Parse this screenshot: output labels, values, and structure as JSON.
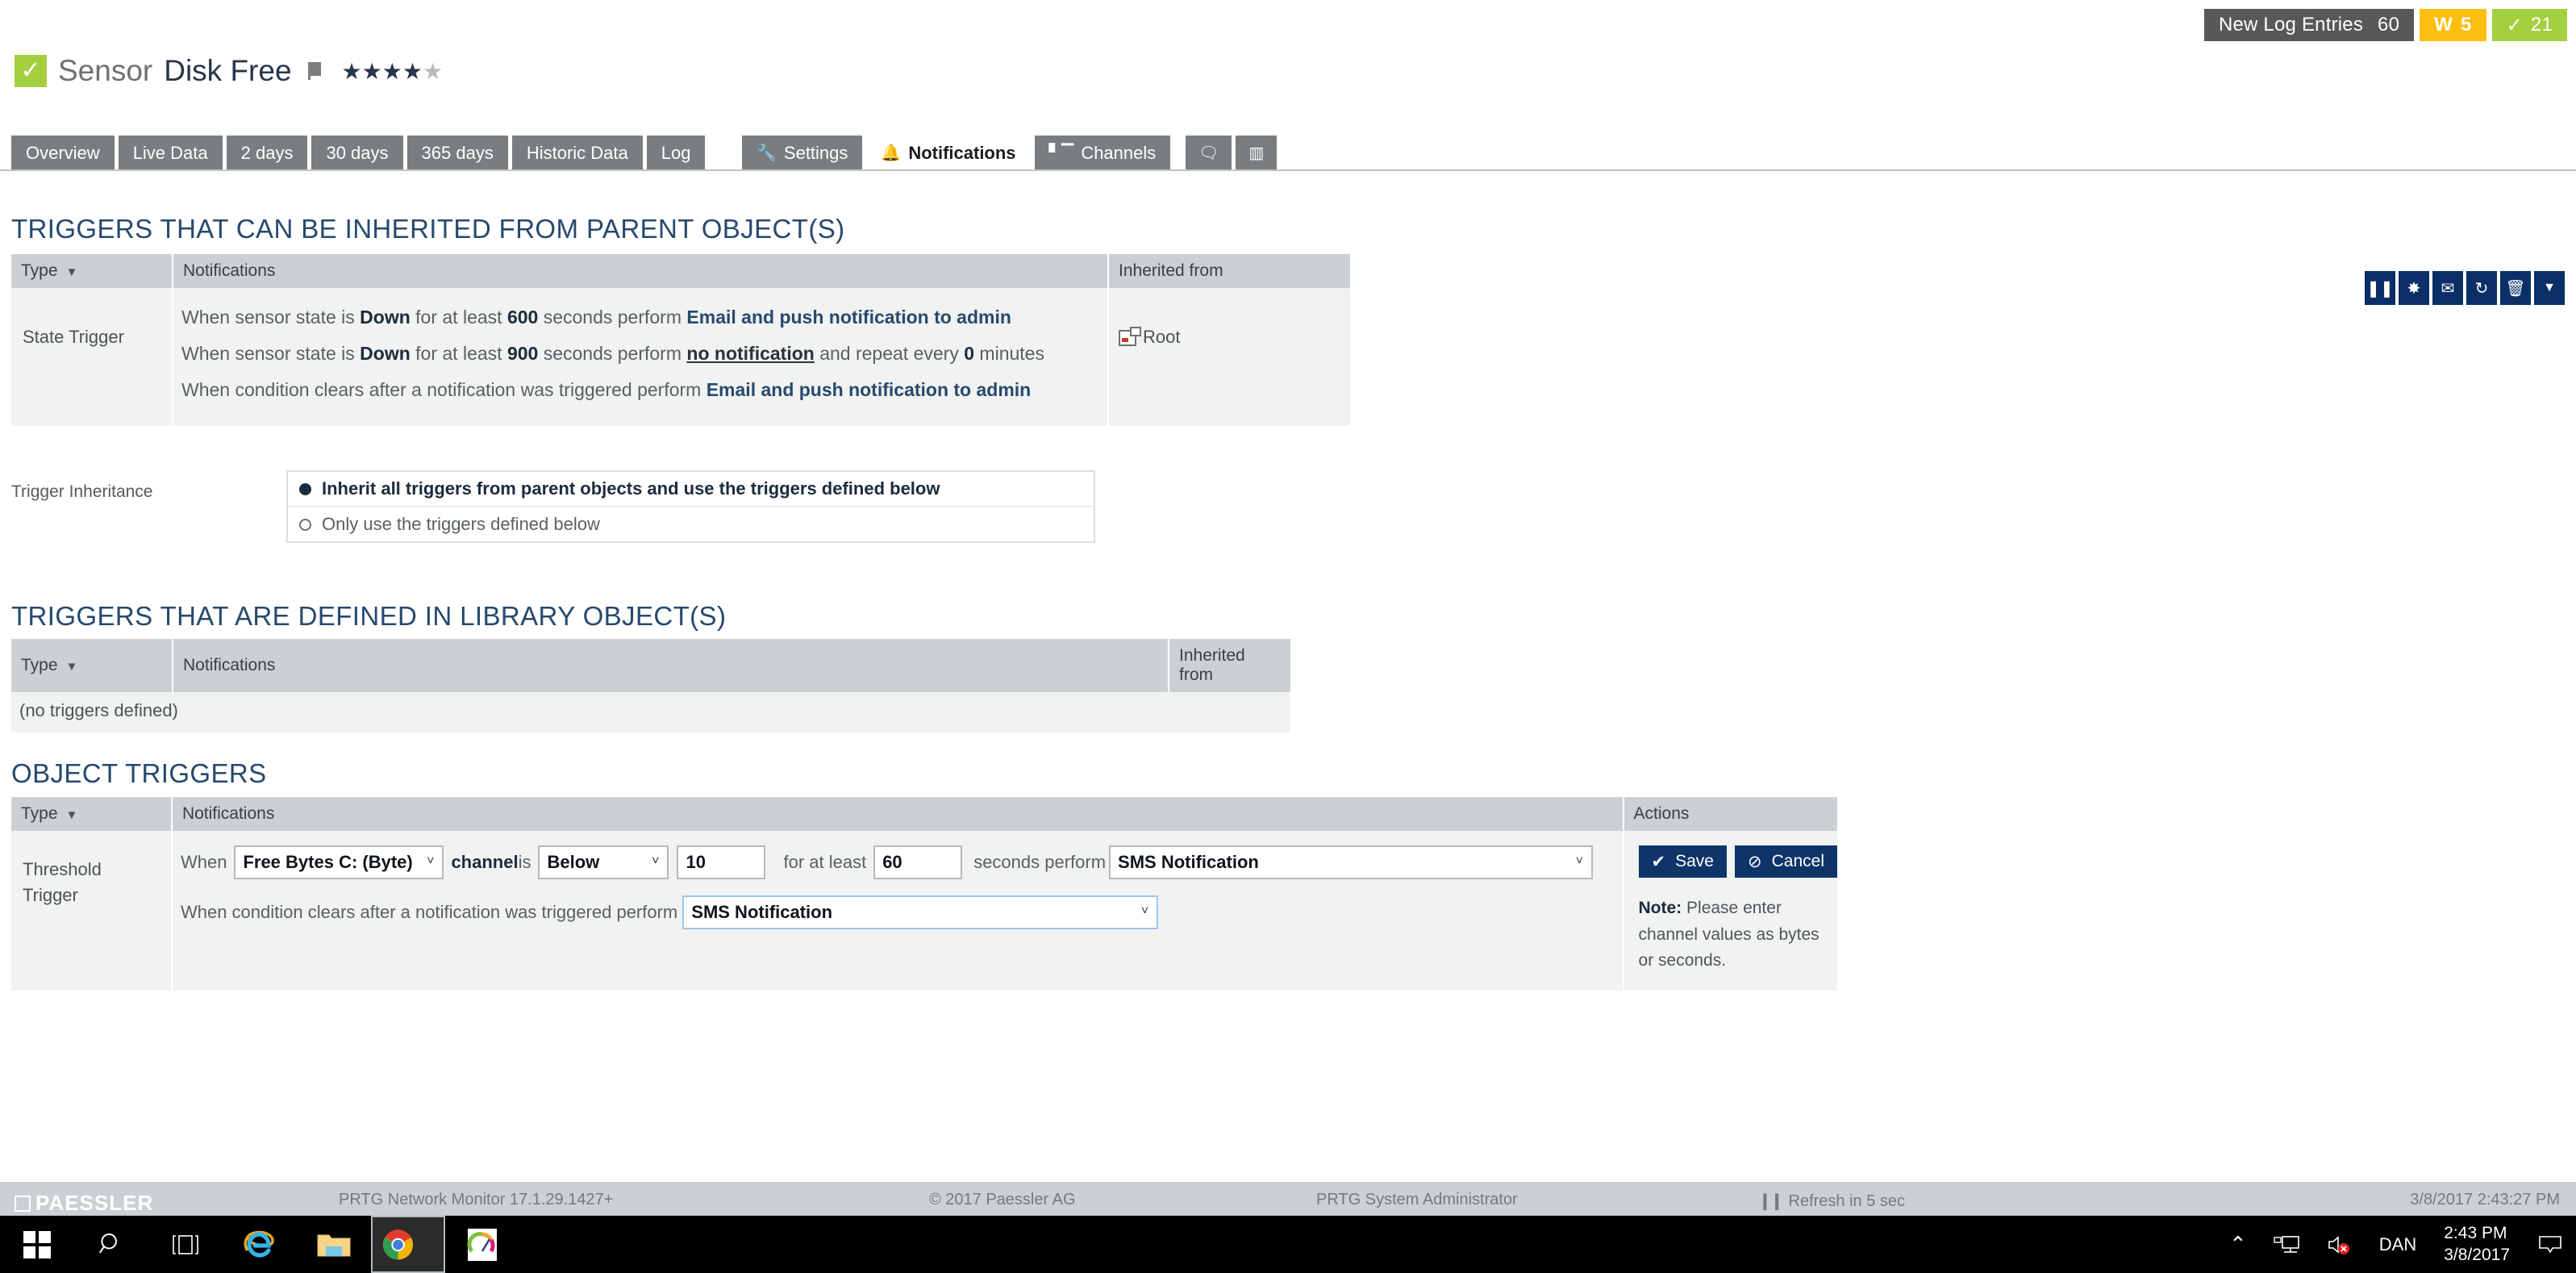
{
  "header": {
    "badges": [
      {
        "name": "new-log-entries",
        "label": "New Log Entries",
        "count": "60",
        "style": "dark"
      },
      {
        "name": "warning",
        "label": "W",
        "count": "5",
        "style": "warn"
      },
      {
        "name": "up",
        "label": "✓",
        "count": "21",
        "style": "ok"
      }
    ],
    "object_kind": "Sensor",
    "object_name": "Disk Free",
    "priority_stars_filled": 4,
    "priority_stars_total": 5,
    "state_icon": "check-icon"
  },
  "tabs": {
    "left": [
      {
        "id": "overview",
        "label": "Overview",
        "active": false
      },
      {
        "id": "live-data",
        "label": "Live Data",
        "active": false
      },
      {
        "id": "2-days",
        "label": "2 days",
        "active": false
      },
      {
        "id": "30-days",
        "label": "30 days",
        "active": false
      },
      {
        "id": "365-days",
        "label": "365 days",
        "active": false
      },
      {
        "id": "historic-data",
        "label": "Historic Data",
        "active": false
      },
      {
        "id": "log",
        "label": "Log",
        "active": false
      }
    ],
    "right": [
      {
        "id": "settings",
        "label": "Settings",
        "icon": "wrench-icon",
        "glyph": "🔧",
        "active": false
      },
      {
        "id": "notifications",
        "label": "Notifications",
        "icon": "bell-icon",
        "glyph": "🔔",
        "active": true
      },
      {
        "id": "channels",
        "label": "Channels",
        "icon": "bar-chart-icon",
        "glyph": "ᴍ",
        "active": false
      },
      {
        "id": "comments",
        "label": "",
        "icon": "comment-icon",
        "glyph": "💬",
        "active": false
      },
      {
        "id": "history",
        "label": "",
        "icon": "notebook-icon",
        "glyph": "▤",
        "active": false
      }
    ]
  },
  "toolbar": [
    {
      "id": "pause",
      "icon": "pause-icon",
      "glyph": "❙❙"
    },
    {
      "id": "new-ticket",
      "icon": "document-star-icon",
      "glyph": "✸"
    },
    {
      "id": "send-email",
      "icon": "envelope-icon",
      "glyph": "✉"
    },
    {
      "id": "scan-now",
      "icon": "refresh-icon",
      "glyph": "↺"
    },
    {
      "id": "delete",
      "icon": "trash-icon",
      "glyph": "🗑"
    },
    {
      "id": "more",
      "icon": "chevron-down-icon",
      "glyph": "▼"
    }
  ],
  "inherited_section": {
    "title": "TRIGGERS THAT CAN BE INHERITED FROM PARENT OBJECT(S)",
    "columns": [
      "Type",
      "Notifications",
      "Inherited from"
    ],
    "rows": [
      {
        "type": "State Trigger",
        "lines": [
          {
            "segments": [
              {
                "t": "When sensor state is ",
                "s": "plain"
              },
              {
                "t": "Down",
                "s": "bold"
              },
              {
                "t": " for at least ",
                "s": "plain"
              },
              {
                "t": "600",
                "s": "bold"
              },
              {
                "t": " seconds perform ",
                "s": "plain"
              },
              {
                "t": "Email and push notification to admin",
                "s": "link"
              }
            ]
          },
          {
            "segments": [
              {
                "t": "When sensor state is ",
                "s": "plain"
              },
              {
                "t": "Down",
                "s": "bold"
              },
              {
                "t": " for at least ",
                "s": "plain"
              },
              {
                "t": "900",
                "s": "bold"
              },
              {
                "t": " seconds perform ",
                "s": "plain"
              },
              {
                "t": "no notification",
                "s": "ulink"
              },
              {
                "t": " and repeat every ",
                "s": "plain"
              },
              {
                "t": "0",
                "s": "bold"
              },
              {
                "t": " minutes",
                "s": "plain"
              }
            ]
          },
          {
            "segments": [
              {
                "t": "When condition clears after a notification was triggered perform ",
                "s": "plain"
              },
              {
                "t": "Email and push notification to admin",
                "s": "link"
              }
            ]
          }
        ],
        "inherited_from": "Root"
      }
    ]
  },
  "trigger_inheritance": {
    "label": "Trigger Inheritance",
    "options": [
      {
        "id": "inherit-all",
        "label": "Inherit all triggers from parent objects and use the triggers defined below",
        "selected": true
      },
      {
        "id": "only-defined",
        "label": "Only use the triggers defined below",
        "selected": false
      }
    ]
  },
  "library_section": {
    "title": "TRIGGERS THAT ARE DEFINED IN LIBRARY OBJECT(S)",
    "columns": [
      "Type",
      "Notifications",
      "Inherited from"
    ],
    "empty_text": "(no triggers defined)"
  },
  "object_triggers": {
    "title": "OBJECT TRIGGERS",
    "columns": [
      "Type",
      "Notifications",
      "Actions"
    ],
    "row": {
      "type": "Threshold Trigger",
      "line1": {
        "when_label": "When",
        "channel_select": {
          "value": "Free Bytes C: (Byte)",
          "caret": "˅"
        },
        "channel_is_label_bold": "channel",
        "channel_is_label": " is",
        "condition_select": {
          "value": "Below",
          "caret": "˅"
        },
        "threshold_value": "10",
        "for_at_least_label": "for at least",
        "seconds_value": "60",
        "seconds_perform_label": "seconds perform",
        "notification_select": {
          "value": "SMS Notification",
          "caret": "˅"
        }
      },
      "line2": {
        "label": "When condition clears after a notification was triggered perform",
        "notification_select": {
          "value": "SMS Notification",
          "caret": "˅"
        }
      }
    },
    "actions": {
      "save_label": "Save",
      "save_glyph": "✔",
      "cancel_label": "Cancel",
      "cancel_glyph": "⊘",
      "note_prefix": "Note:",
      "note_text": " Please enter channel values as bytes or seconds."
    }
  },
  "footer": {
    "brand": "PAESSLER",
    "product": "PRTG Network Monitor 17.1.29.1427+",
    "copyright": "© 2017 Paessler AG",
    "user": "PRTG System Administrator",
    "refresh": "Refresh in 5 sec",
    "refresh_glyph": "❙❙",
    "datetime": "3/8/2017 2:43:27 PM"
  },
  "taskbar": {
    "items": [
      {
        "id": "start",
        "icon": "windows-logo-icon"
      },
      {
        "id": "search",
        "icon": "search-icon",
        "glyph": "⌕"
      },
      {
        "id": "task-view",
        "icon": "task-view-icon",
        "glyph": "❑"
      },
      {
        "id": "internet-explorer",
        "icon": "internet-explorer-icon",
        "glyph": "e"
      },
      {
        "id": "file-explorer",
        "icon": "folder-icon",
        "glyph": "🗁"
      },
      {
        "id": "chrome",
        "icon": "chrome-icon",
        "glyph": "●",
        "selected": true
      },
      {
        "id": "prtg-app",
        "icon": "gauge-icon",
        "glyph": "◔"
      }
    ],
    "tray": {
      "chevron": "⌃",
      "network_icon": "network-icon",
      "volume_icon": "volume-muted-icon",
      "keyboard_layout": "DAN",
      "time": "2:43 PM",
      "date": "3/8/2017",
      "action_center_icon": "action-center-icon"
    }
  },
  "colors": {
    "accent": "#27496d",
    "ok_green": "#a4cf3f",
    "warn_yellow": "#fdbe10",
    "button_blue": "#0e3468",
    "header_gray": "#cdd0d2"
  }
}
